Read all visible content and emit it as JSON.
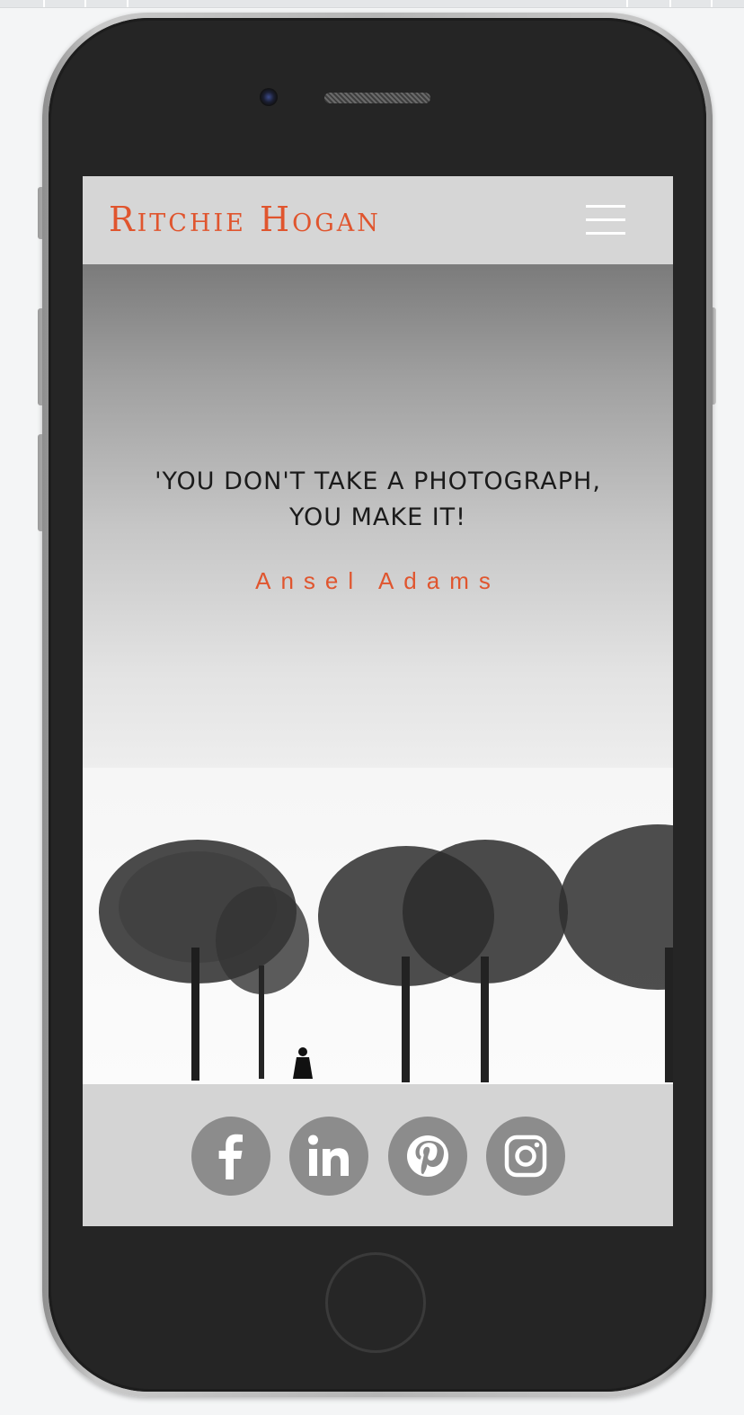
{
  "header": {
    "site_title": "Ritchie Hogan",
    "menu_icon": "hamburger-menu-icon"
  },
  "hero": {
    "quote_line1": "'YOU DON'T TAKE A PHOTOGRAPH,",
    "quote_line2": "YOU MAKE IT!",
    "author": "Ansel Adams",
    "image": "winter trees landscape with walking figure"
  },
  "social": {
    "links": [
      {
        "name": "Facebook",
        "icon": "facebook-icon"
      },
      {
        "name": "LinkedIn",
        "icon": "linkedin-icon"
      },
      {
        "name": "Pinterest",
        "icon": "pinterest-icon"
      },
      {
        "name": "Instagram",
        "icon": "instagram-icon"
      }
    ]
  },
  "colors": {
    "accent": "#e0552e",
    "header_bg": "#d6d6d6",
    "social_icon_bg": "#8c8c8c",
    "device_body": "#252525"
  }
}
